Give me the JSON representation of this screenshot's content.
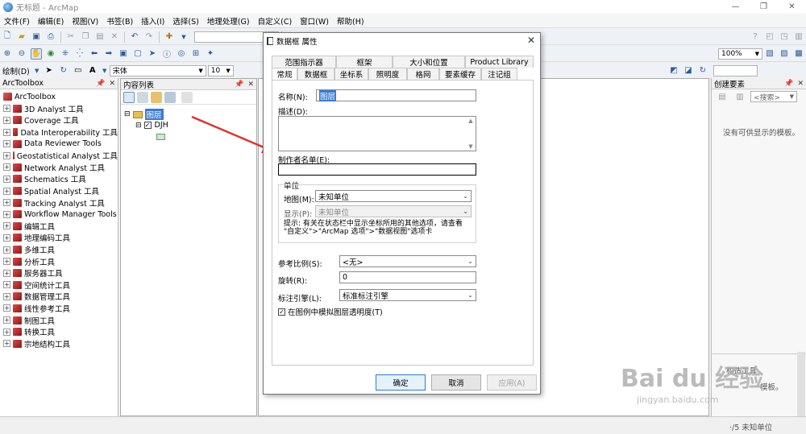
{
  "window": {
    "title": "无标题 - ArcMap",
    "min": "—",
    "max": "❐",
    "close": "✕"
  },
  "menu": [
    "文件(F)",
    "编辑(E)",
    "视图(V)",
    "书签(B)",
    "插入(I)",
    "选择(S)",
    "地理处理(G)",
    "自定义(C)",
    "窗口(W)",
    "帮助(H)"
  ],
  "toolbar3": {
    "draw_label": "绘制(D)",
    "font": "宋体",
    "size": "10",
    "zoom": "100%"
  },
  "toolbox": {
    "title": "ArcToolbox",
    "root": "ArcToolbox",
    "items": [
      "3D Analyst 工具",
      "Coverage 工具",
      "Data Interoperability 工具",
      "Data Reviewer Tools",
      "Geostatistical Analyst 工具",
      "Network Analyst 工具",
      "Schematics 工具",
      "Spatial Analyst 工具",
      "Tracking Analyst 工具",
      "Workflow Manager Tools",
      "编辑工具",
      "地理编码工具",
      "多维工具",
      "分析工具",
      "服务器工具",
      "空间统计工具",
      "数据管理工具",
      "线性参考工具",
      "制图工具",
      "转换工具",
      "宗地结构工具"
    ]
  },
  "toc": {
    "title": "内容列表",
    "layer_group": "图层",
    "layer": "DJH"
  },
  "create": {
    "title": "创建要素",
    "search": "<搜索>",
    "empty": "没有可供显示的模板。",
    "construct": "构造工具",
    "no_template": "模板。",
    "unknown_unit": "未知单位"
  },
  "dialog": {
    "title": "数据框 属性",
    "tabs_top": [
      "范围指示器",
      "框架",
      "大小和位置",
      "Product Library"
    ],
    "tabs_bottom": [
      "常规",
      "数据框",
      "坐标系",
      "照明度",
      "格网",
      "要素缓存",
      "注记组"
    ],
    "name_label": "名称(N):",
    "name_value": "图层",
    "desc_label": "描述(D):",
    "credits_label": "制作者名单(E):",
    "units_group": "单位",
    "map_units_label": "地图(M):",
    "map_units_value": "未知单位",
    "display_units_label": "显示(P):",
    "display_units_value": "未知单位",
    "tip": "提示: 有关在状态栏中显示坐标所用的其他选项，请查看\n\"自定义\">\"ArcMap 选项\">\"数据视图\"选项卡",
    "ref_scale_label": "参考比例(S):",
    "ref_scale_value": "<无>",
    "rotation_label": "旋转(R):",
    "rotation_value": "0",
    "label_engine_label": "标注引擎(L):",
    "label_engine_value": "标准标注引擎",
    "simulate_label": "在图例中模拟图层透明度(T)",
    "ok": "确定",
    "cancel": "取消",
    "apply": "应用(A)"
  },
  "watermark": {
    "brand": "Bai du 经验",
    "url": "jingyan.baidu.com"
  }
}
